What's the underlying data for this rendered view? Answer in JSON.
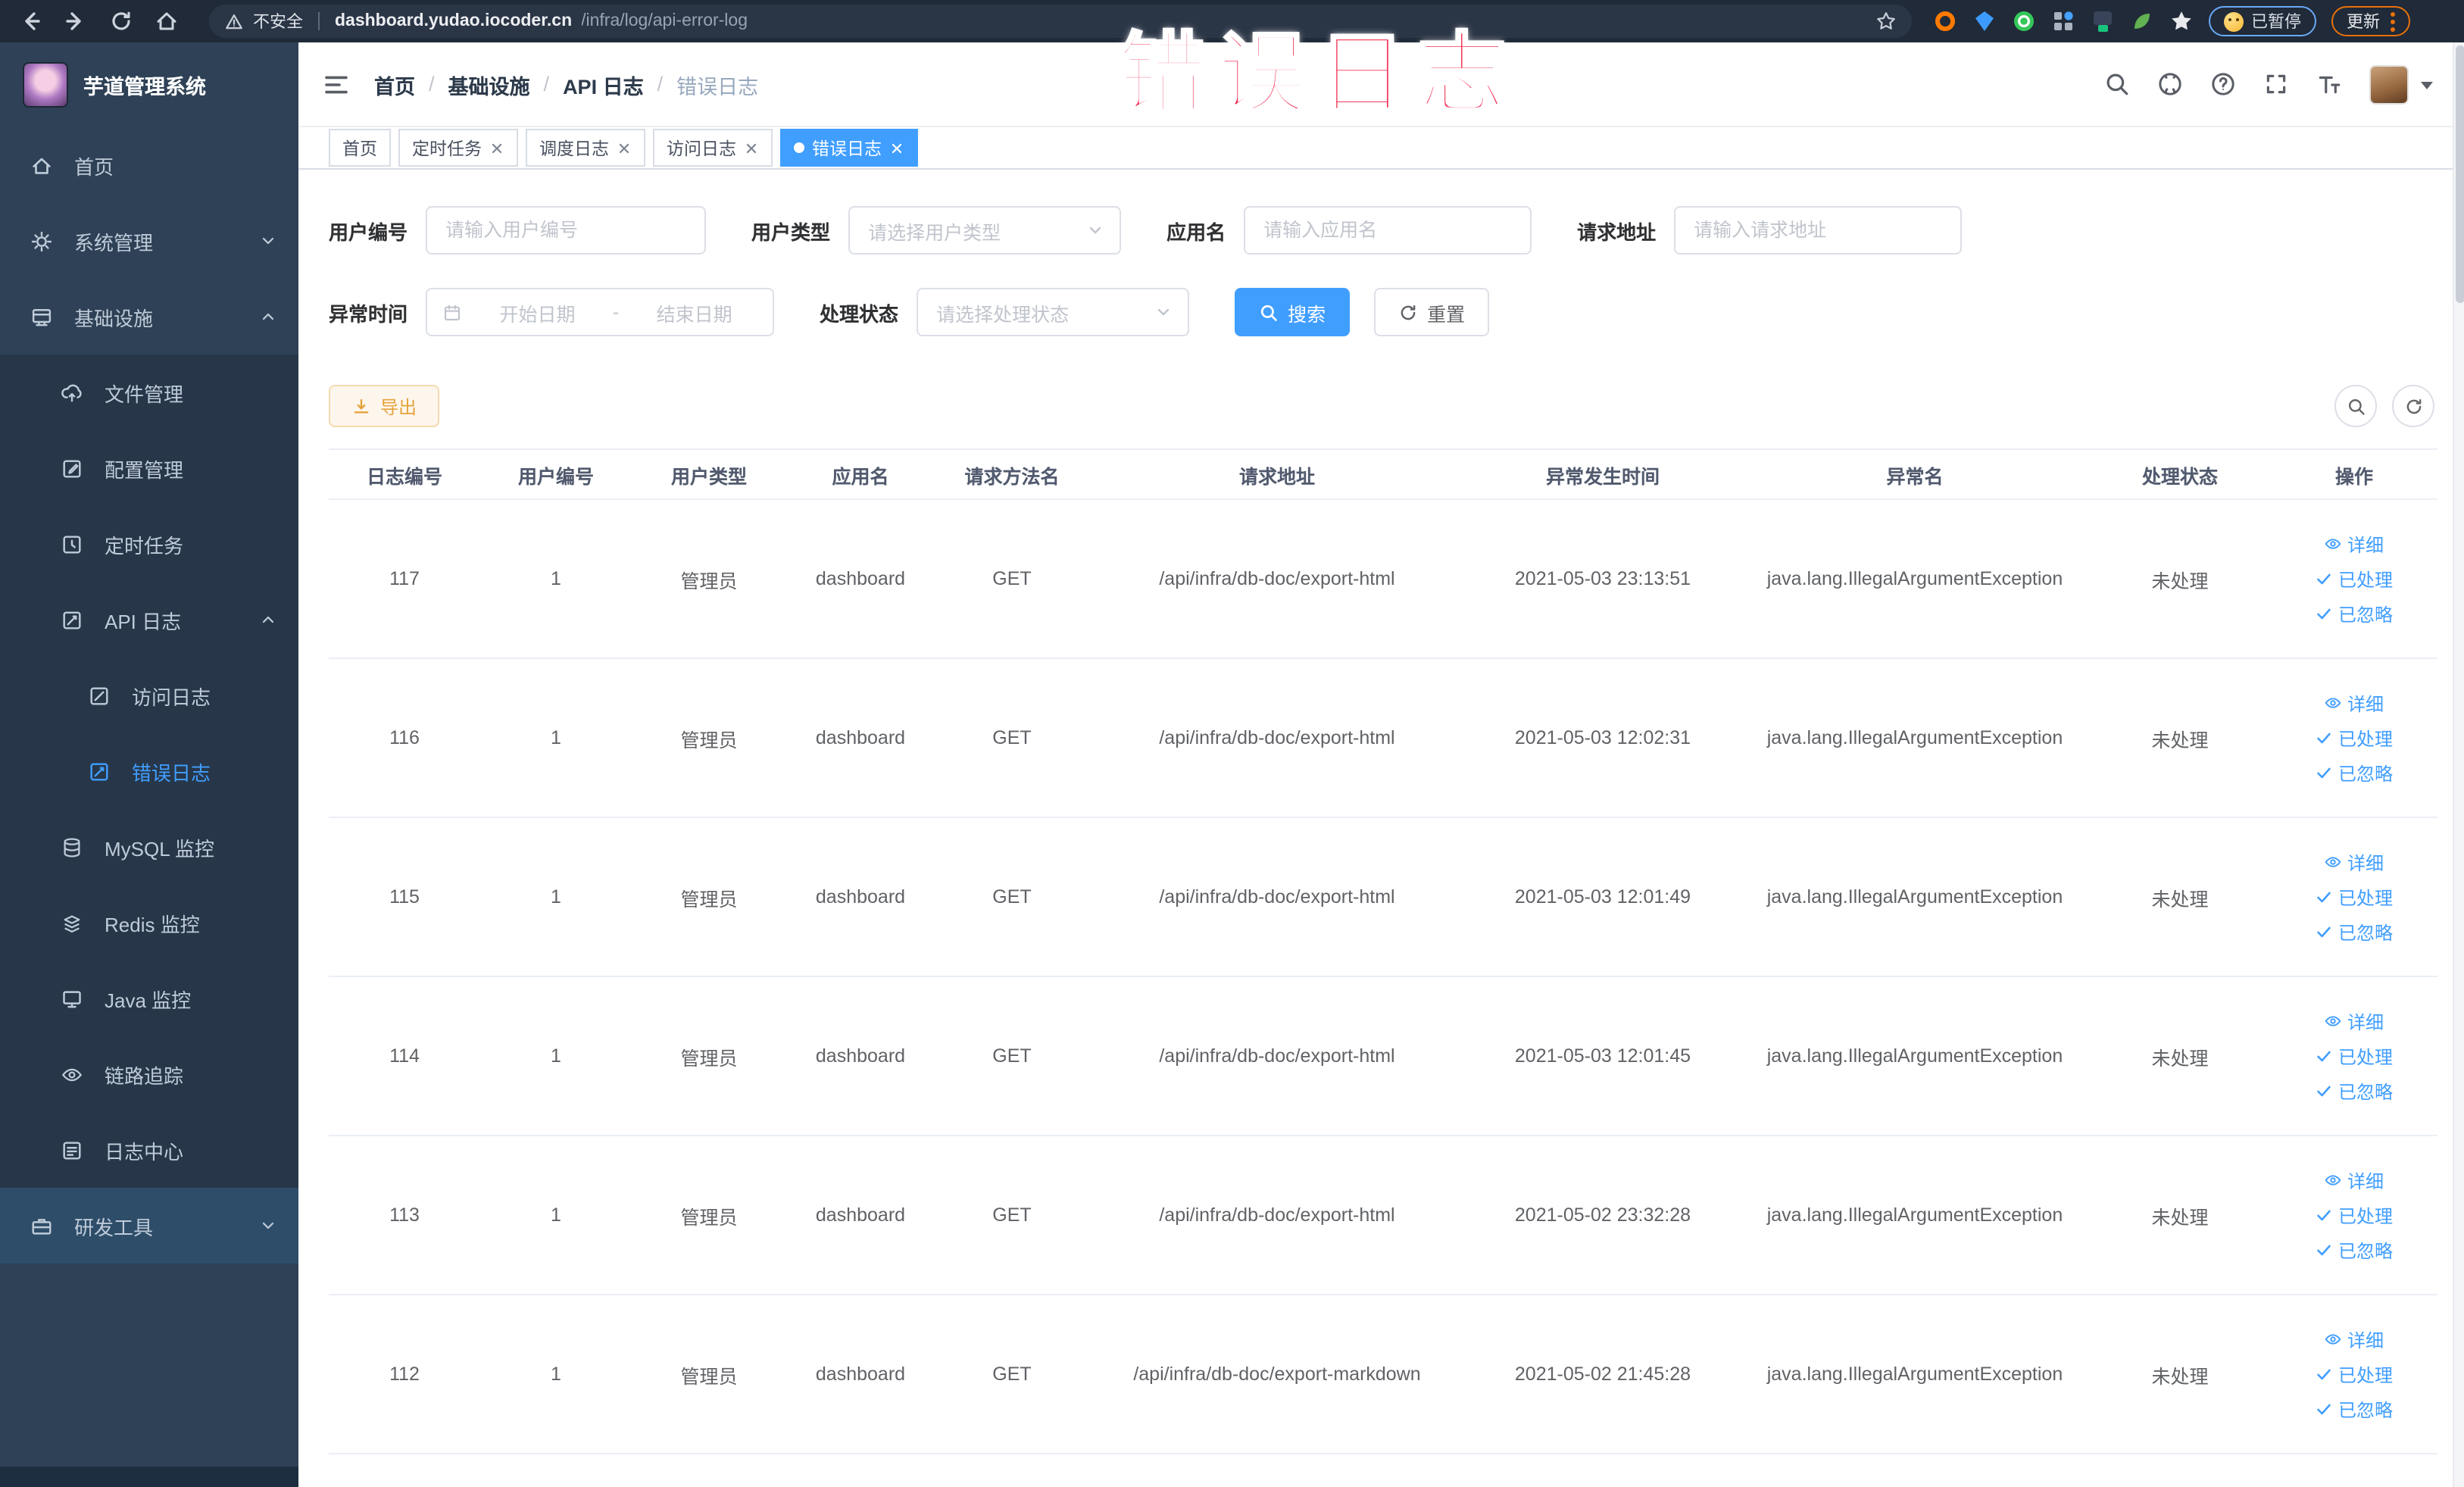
{
  "colors": {
    "accent_blue": "#409eff",
    "watermark_red": "#f1264d",
    "sidebar_bg": "#2e4156",
    "sidebar_submenu_bg": "#273749",
    "chrome_bar_bg": "#202a38",
    "export_button_text": "#e6a23c",
    "export_button_bg": "#fdf6ec"
  },
  "browser": {
    "security_label": "不安全",
    "url_host": "dashboard.yudao.iocoder.cn",
    "url_path": "/infra/log/api-error-log",
    "paused_badge": "已暂停",
    "update_label": "更新"
  },
  "watermark": {
    "text": "错误日志"
  },
  "sidebar": {
    "title": "芋道管理系统",
    "items": [
      {
        "label": "首页"
      },
      {
        "label": "系统管理"
      },
      {
        "label": "基础设施"
      },
      {
        "label": "文件管理"
      },
      {
        "label": "配置管理"
      },
      {
        "label": "定时任务"
      },
      {
        "label": "API 日志"
      },
      {
        "label": "访问日志"
      },
      {
        "label": "错误日志"
      },
      {
        "label": "MySQL 监控"
      },
      {
        "label": "Redis 监控"
      },
      {
        "label": "Java 监控"
      },
      {
        "label": "链路追踪"
      },
      {
        "label": "日志中心"
      },
      {
        "label": "研发工具"
      }
    ]
  },
  "breadcrumb": {
    "separator": "/",
    "items": [
      "首页",
      "基础设施",
      "API 日志",
      "错误日志"
    ]
  },
  "tabs": [
    {
      "label": "首页"
    },
    {
      "label": "定时任务"
    },
    {
      "label": "调度日志"
    },
    {
      "label": "访问日志"
    },
    {
      "label": "错误日志"
    }
  ],
  "filters": {
    "user_id": {
      "label": "用户编号",
      "placeholder": "请输入用户编号",
      "value": ""
    },
    "user_type": {
      "label": "用户类型",
      "placeholder": "请选择用户类型",
      "value": ""
    },
    "app_name": {
      "label": "应用名",
      "placeholder": "请输入应用名",
      "value": ""
    },
    "request_url": {
      "label": "请求地址",
      "placeholder": "请输入请求地址",
      "value": ""
    },
    "exception_time": {
      "label": "异常时间",
      "start_placeholder": "开始日期",
      "separator": "-",
      "end_placeholder": "结束日期"
    },
    "process_status": {
      "label": "处理状态",
      "placeholder": "请选择处理状态",
      "value": ""
    },
    "search_button": "搜索",
    "reset_button": "重置"
  },
  "toolbar": {
    "export_button": "导出"
  },
  "table": {
    "columns": [
      "日志编号",
      "用户编号",
      "用户类型",
      "应用名",
      "请求方法名",
      "请求地址",
      "异常发生时间",
      "异常名",
      "处理状态",
      "操作"
    ],
    "actions": [
      "详细",
      "已处理",
      "已忽略"
    ],
    "rows": [
      {
        "log_id": "117",
        "user_id": "1",
        "user_type": "管理员",
        "app_name": "dashboard",
        "method": "GET",
        "url": "/api/infra/db-doc/export-html",
        "time": "2021-05-03 23:13:51",
        "exception": "java.lang.IllegalArgumentException",
        "status": "未处理"
      },
      {
        "log_id": "116",
        "user_id": "1",
        "user_type": "管理员",
        "app_name": "dashboard",
        "method": "GET",
        "url": "/api/infra/db-doc/export-html",
        "time": "2021-05-03 12:02:31",
        "exception": "java.lang.IllegalArgumentException",
        "status": "未处理"
      },
      {
        "log_id": "115",
        "user_id": "1",
        "user_type": "管理员",
        "app_name": "dashboard",
        "method": "GET",
        "url": "/api/infra/db-doc/export-html",
        "time": "2021-05-03 12:01:49",
        "exception": "java.lang.IllegalArgumentException",
        "status": "未处理"
      },
      {
        "log_id": "114",
        "user_id": "1",
        "user_type": "管理员",
        "app_name": "dashboard",
        "method": "GET",
        "url": "/api/infra/db-doc/export-html",
        "time": "2021-05-03 12:01:45",
        "exception": "java.lang.IllegalArgumentException",
        "status": "未处理"
      },
      {
        "log_id": "113",
        "user_id": "1",
        "user_type": "管理员",
        "app_name": "dashboard",
        "method": "GET",
        "url": "/api/infra/db-doc/export-html",
        "time": "2021-05-02 23:32:28",
        "exception": "java.lang.IllegalArgumentException",
        "status": "未处理"
      },
      {
        "log_id": "112",
        "user_id": "1",
        "user_type": "管理员",
        "app_name": "dashboard",
        "method": "GET",
        "url": "/api/infra/db-doc/export-markdown",
        "time": "2021-05-02 21:45:28",
        "exception": "java.lang.IllegalArgumentException",
        "status": "未处理"
      }
    ]
  }
}
